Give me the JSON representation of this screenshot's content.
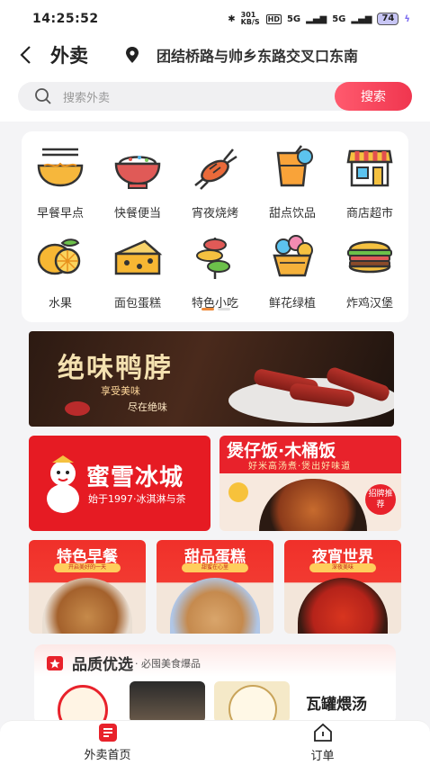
{
  "status_bar": {
    "time": "14:25:52",
    "speed": "301 KB/S",
    "hd": "HD",
    "signal1": "5G",
    "signal2": "5G",
    "battery": "74"
  },
  "header": {
    "title": "外卖",
    "address": "团结桥路与帅乡东路交叉口东南"
  },
  "search": {
    "placeholder": "搜索外卖",
    "button_label": "搜索"
  },
  "categories": [
    {
      "label": "早餐早点",
      "icon": "noodle-bowl-icon"
    },
    {
      "label": "快餐便当",
      "icon": "rice-bowl-icon"
    },
    {
      "label": "宵夜烧烤",
      "icon": "crayfish-icon"
    },
    {
      "label": "甜点饮品",
      "icon": "drink-icon"
    },
    {
      "label": "商店超市",
      "icon": "store-icon"
    },
    {
      "label": "水果",
      "icon": "lemon-icon"
    },
    {
      "label": "面包蛋糕",
      "icon": "cheese-cake-icon"
    },
    {
      "label": "特色小吃",
      "icon": "skewer-snack-icon"
    },
    {
      "label": "鲜花绿植",
      "icon": "flower-basket-icon"
    },
    {
      "label": "炸鸡汉堡",
      "icon": "burger-icon"
    }
  ],
  "banner": {
    "title": "绝味鸭脖",
    "line1": "享受美味",
    "line2": "尽在绝味"
  },
  "promos": {
    "mixue_name": "蜜雪冰城",
    "mixue_slogan": "始于1997·冰淇淋与茶",
    "claypot_title": "煲仔饭·木桶饭",
    "claypot_sub": "好米高汤煮·煲出好味道",
    "claypot_stamp": "招牌推荐"
  },
  "features": [
    {
      "title": "特色早餐",
      "tag": "开启美好的一天"
    },
    {
      "title": "甜品蛋糕",
      "tag": "甜蜜在心里"
    },
    {
      "title": "夜宵世界",
      "tag": "深夜美味"
    }
  ],
  "quality": {
    "title": "品质优选",
    "subtitle": "· 必囤美食爆品",
    "shop4_text": "瓦罐煨汤"
  },
  "tabbar": {
    "home": "外卖首页",
    "orders": "订单"
  }
}
